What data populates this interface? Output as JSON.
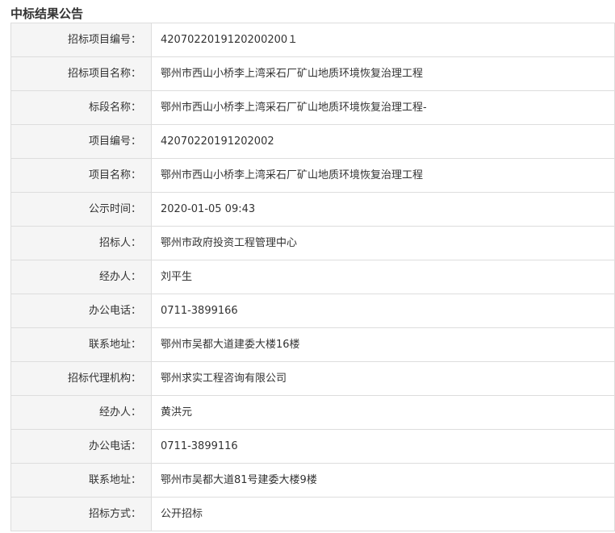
{
  "page": {
    "title": "中标结果公告"
  },
  "rows": [
    {
      "label": "招标项目编号：",
      "value": "4207022019120200200１"
    },
    {
      "label": "招标项目名称：",
      "value": "鄂州市西山小桥李上湾采石厂矿山地质环境恢复治理工程"
    },
    {
      "label": "标段名称：",
      "value": "鄂州市西山小桥李上湾采石厂矿山地质环境恢复治理工程-"
    },
    {
      "label": "项目编号：",
      "value": "42070220191202002"
    },
    {
      "label": "项目名称：",
      "value": "鄂州市西山小桥李上湾采石厂矿山地质环境恢复治理工程"
    },
    {
      "label": "公示时间：",
      "value": "2020-01-05 09:43"
    },
    {
      "label": "招标人：",
      "value": "鄂州市政府投资工程管理中心"
    },
    {
      "label": "经办人：",
      "value": "刘平生"
    },
    {
      "label": "办公电话：",
      "value": "0711-3899166"
    },
    {
      "label": "联系地址：",
      "value": "鄂州市吴都大道建委大楼16楼"
    },
    {
      "label": "招标代理机构：",
      "value": "鄂州求实工程咨询有限公司"
    },
    {
      "label": "经办人：",
      "value": "黄洪元"
    },
    {
      "label": "办公电话：",
      "value": "0711-3899116"
    },
    {
      "label": "联系地址：",
      "value": "鄂州市吴都大道81号建委大楼9楼"
    },
    {
      "label": "招标方式：",
      "value": "公开招标"
    }
  ]
}
